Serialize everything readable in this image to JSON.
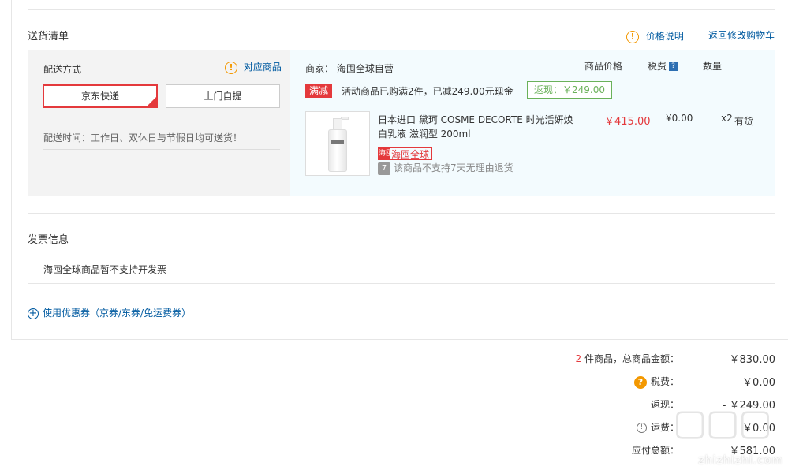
{
  "delivery": {
    "section_title": "送货清单",
    "price_note_label": "价格说明",
    "back_to_cart_label": "返回修改购物车",
    "method_label": "配送方式",
    "applicable_items_label": "对应商品",
    "options": [
      {
        "label": "京东快递",
        "selected": true
      },
      {
        "label": "上门自提",
        "selected": false
      }
    ],
    "time_text": "配送时间：工作日、双休日与节假日均可送货！"
  },
  "merchant": {
    "label": "商家：",
    "name": "海囤全球自营"
  },
  "columns": {
    "price": "商品价格",
    "tax": "税费",
    "quantity": "数量"
  },
  "promotion": {
    "tag": "满减",
    "text": "活动商品已购满2件，已减249.00元现金",
    "rebate": "返现：￥249.00"
  },
  "product": {
    "title_line1": "日本进口 黛珂 COSME DECORTE 时光活妍焕",
    "title_line2": "白乳液 滋润型 200ml",
    "badge": "海囤全球",
    "badge_icon_text": "海囤",
    "return_icon_text": "7",
    "return_policy": "该商品不支持7天无理由退货",
    "price": "￥415.00",
    "tax": "¥0.00",
    "quantity": "x2",
    "stock": "有货"
  },
  "invoice": {
    "section_title": "发票信息",
    "note": "海囤全球商品暂不支持开发票"
  },
  "coupon": {
    "label": "使用优惠券（京券/东券/免运费券）"
  },
  "summary": {
    "count": "2",
    "count_suffix": "件商品，总商品金额：",
    "total_value": "￥830.00",
    "tax_label": "税费：",
    "tax_value": "￥0.00",
    "rebate_label": "返现：",
    "rebate_value": "- ￥249.00",
    "shipping_label": "运费：",
    "shipping_value": "￥0.00",
    "payable_label": "应付总额：",
    "payable_value": "￥581.00"
  },
  "watermark": "zhizhizhi.com",
  "colors": {
    "accent_red": "#e4393c",
    "link_blue": "#005aa0",
    "warn_orange": "#f39800",
    "rebate_green": "#6ab15a"
  }
}
